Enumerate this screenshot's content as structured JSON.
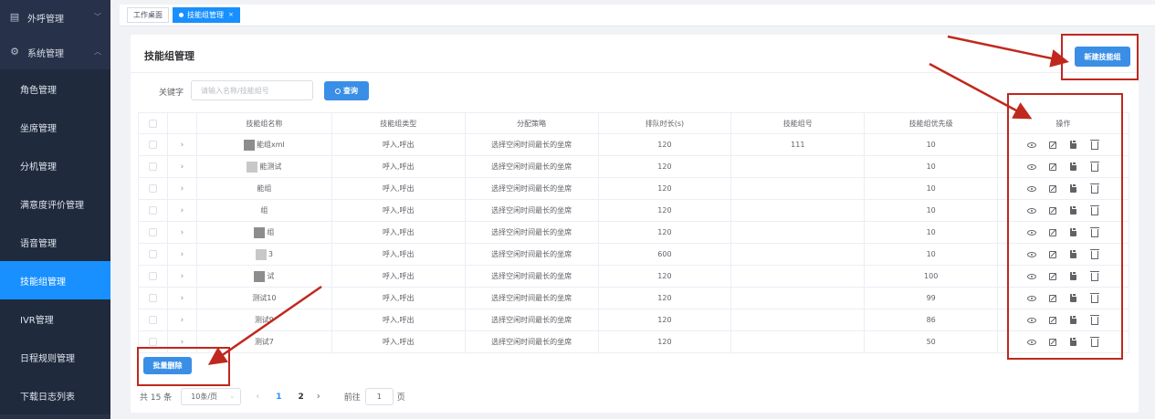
{
  "sidebar": {
    "groups": [
      {
        "label": "外呼管理",
        "icon": "document-icon",
        "chevron": "﹀"
      },
      {
        "label": "系统管理",
        "icon": "gear-icon",
        "chevron": "︿"
      }
    ],
    "items": [
      {
        "label": "角色管理",
        "active": false
      },
      {
        "label": "坐席管理",
        "active": false
      },
      {
        "label": "分机管理",
        "active": false
      },
      {
        "label": "满意度评价管理",
        "active": false
      },
      {
        "label": "语音管理",
        "active": false
      },
      {
        "label": "技能组管理",
        "active": true
      },
      {
        "label": "IVR管理",
        "active": false
      },
      {
        "label": "日程规则管理",
        "active": false
      },
      {
        "label": "下载日志列表",
        "active": false
      }
    ]
  },
  "tabs": [
    {
      "label": "工作桌面",
      "active": false
    },
    {
      "label": "技能组管理",
      "active": true,
      "close": "×"
    }
  ],
  "page": {
    "title": "技能组管理",
    "new_button": "新建技能组",
    "keyword_label": "关键字",
    "keyword_placeholder": "请输入名称/技能组号",
    "search_button": "查询",
    "batch_delete_button": "批量删除"
  },
  "table": {
    "columns": [
      "技能组名称",
      "技能组类型",
      "分配策略",
      "排队时长(s)",
      "技能组号",
      "技能组优先级",
      "操作"
    ],
    "rows": [
      {
        "name": "能组xml",
        "mask": "dark",
        "type": "呼入,呼出",
        "strategy": "选择空闲时间最长的坐席",
        "queue": "120",
        "number": "111",
        "priority": "10"
      },
      {
        "name": "能测试",
        "mask": "light",
        "type": "呼入,呼出",
        "strategy": "选择空闲时间最长的坐席",
        "queue": "120",
        "number": "",
        "priority": "10"
      },
      {
        "name": "能组",
        "mask": "none",
        "type": "呼入,呼出",
        "strategy": "选择空闲时间最长的坐席",
        "queue": "120",
        "number": "",
        "priority": "10"
      },
      {
        "name": "组",
        "mask": "none",
        "type": "呼入,呼出",
        "strategy": "选择空闲时间最长的坐席",
        "queue": "120",
        "number": "",
        "priority": "10"
      },
      {
        "name": "组",
        "mask": "dark",
        "type": "呼入,呼出",
        "strategy": "选择空闲时间最长的坐席",
        "queue": "120",
        "number": "",
        "priority": "10"
      },
      {
        "name": "3",
        "mask": "light",
        "type": "呼入,呼出",
        "strategy": "选择空闲时间最长的坐席",
        "queue": "600",
        "number": "",
        "priority": "10"
      },
      {
        "name": "试",
        "mask": "dark",
        "type": "呼入,呼出",
        "strategy": "选择空闲时间最长的坐席",
        "queue": "120",
        "number": "",
        "priority": "100"
      },
      {
        "name": "测试10",
        "mask": "none",
        "type": "呼入,呼出",
        "strategy": "选择空闲时间最长的坐席",
        "queue": "120",
        "number": "",
        "priority": "99"
      },
      {
        "name": "测试9",
        "mask": "none",
        "type": "呼入,呼出",
        "strategy": "选择空闲时间最长的坐席",
        "queue": "120",
        "number": "",
        "priority": "86"
      },
      {
        "name": "测试7",
        "mask": "none",
        "type": "呼入,呼出",
        "strategy": "选择空闲时间最长的坐席",
        "queue": "120",
        "number": "",
        "priority": "50"
      }
    ],
    "row_icons": [
      "eye-icon",
      "edit-icon",
      "clipboard-icon",
      "trash-icon"
    ]
  },
  "pagination": {
    "total": "共 15 条",
    "page_size": "10条/页",
    "pages": [
      "1",
      "2"
    ],
    "current": "1",
    "goto_label": "前往",
    "goto_value": "1",
    "page_unit": "页"
  },
  "colors": {
    "sidebar_bg": "#27324a",
    "accent": "#1890ff",
    "annotation": "#c0281e"
  }
}
